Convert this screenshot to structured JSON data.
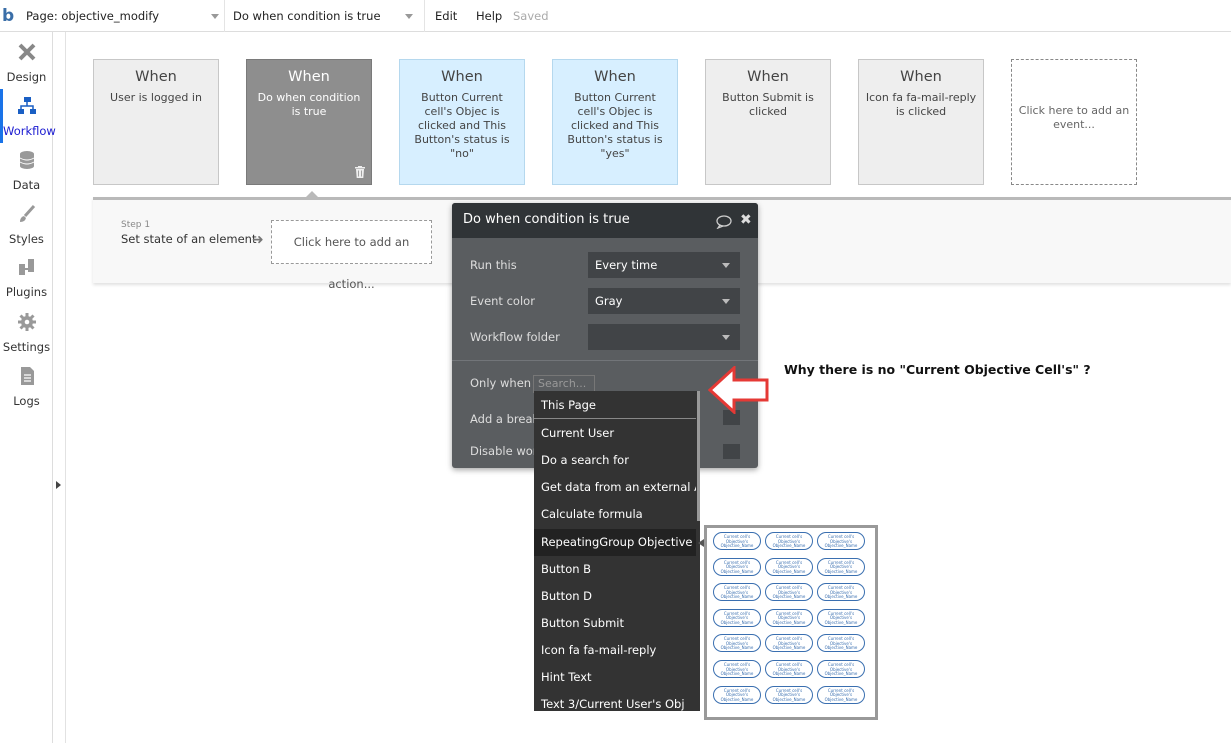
{
  "topbar": {
    "logo": "b",
    "page_select": "Page: objective_modify",
    "event_select": "Do when condition is true",
    "edit": "Edit",
    "help": "Help",
    "saved": "Saved"
  },
  "sidebar": {
    "items": [
      {
        "label": "Design",
        "icon": "design-icon"
      },
      {
        "label": "Workflow",
        "icon": "workflow-icon"
      },
      {
        "label": "Data",
        "icon": "data-icon"
      },
      {
        "label": "Styles",
        "icon": "styles-icon"
      },
      {
        "label": "Plugins",
        "icon": "plugins-icon"
      },
      {
        "label": "Settings",
        "icon": "settings-icon"
      },
      {
        "label": "Logs",
        "icon": "logs-icon"
      }
    ],
    "active": "Workflow"
  },
  "events": [
    {
      "when": "When",
      "desc": "User is logged in",
      "style": "default"
    },
    {
      "when": "When",
      "desc": "Do when condition is true",
      "style": "gray"
    },
    {
      "when": "When",
      "desc": "Button Current cell's Objec is clicked and This Button's status is \"no\"",
      "style": "blue"
    },
    {
      "when": "When",
      "desc": "Button Current cell's Objec is clicked and This Button's status is \"yes\"",
      "style": "blue"
    },
    {
      "when": "When",
      "desc": "Button Submit is clicked",
      "style": "default"
    },
    {
      "when": "When",
      "desc": "Icon fa fa-mail-reply is clicked",
      "style": "default"
    },
    {
      "when": "",
      "desc": "Click here to add an event...",
      "style": "add"
    }
  ],
  "step": {
    "number": "Step 1",
    "label": "Set state of an element",
    "add_action": "Click here to add an action..."
  },
  "editor": {
    "title": "Do when condition is true",
    "run_this_label": "Run this",
    "run_this_value": "Every time",
    "event_color_label": "Event color",
    "event_color_value": "Gray",
    "workflow_folder_label": "Workflow folder",
    "workflow_folder_value": "",
    "only_when_label": "Only when",
    "search_placeholder": "Search...",
    "breakpoint_label": "Add a breakp",
    "disable_label": "Disable work"
  },
  "dropdown": {
    "items": [
      "This Page",
      "Current User",
      "Do a search for",
      "Get data from an external API",
      "Calculate formula",
      "RepeatingGroup Objective",
      "Button B",
      "Button D",
      "Button Submit",
      "Icon fa fa-mail-reply",
      "Hint Text",
      "Text 3/Current User's Obj"
    ],
    "selected": "RepeatingGroup Objective"
  },
  "preview": {
    "cell_text": "Current cell's Objective's Objective_Name"
  },
  "annotation": {
    "question": "Why there is no \"Current Objective Cell's\" ?",
    "arrow_color": "#e53935"
  },
  "colors": {
    "accent": "#1a73e8",
    "card_gray": "#8e8e8e",
    "card_blue": "#d7efff",
    "editor_bg": "#5a5d60",
    "editor_head": "#303437"
  }
}
